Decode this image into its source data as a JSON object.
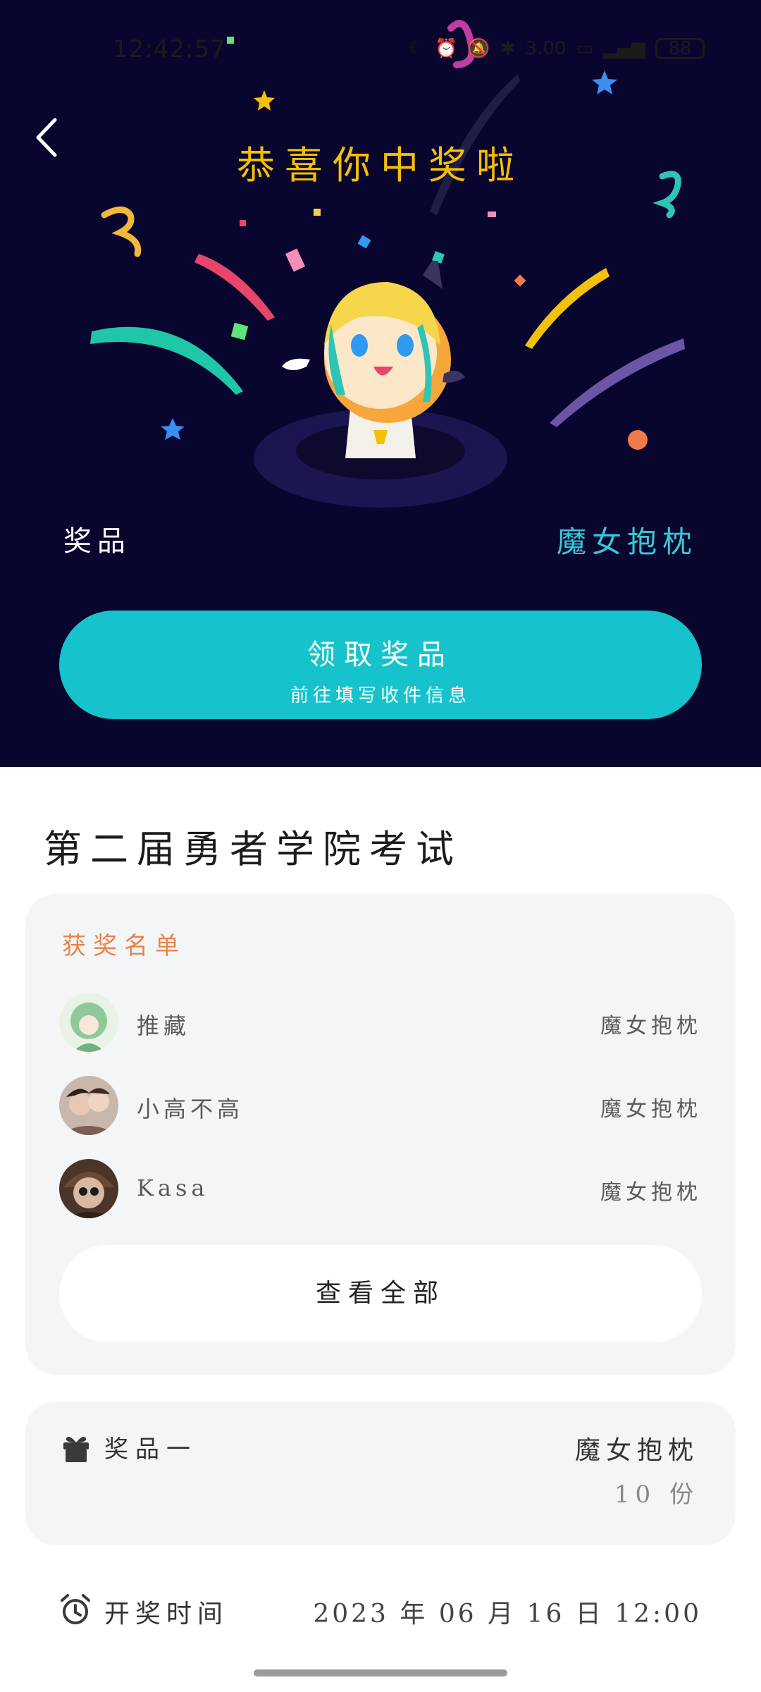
{
  "status_bar": {
    "time": "12:42:57",
    "icons": [
      "moon-icon",
      "alarm-icon",
      "mute-icon",
      "bluetooth-icon",
      "speed-icon",
      "hd-icon",
      "signal-icon"
    ],
    "network_speed": "3.00",
    "battery": "88"
  },
  "hero": {
    "title": "恭喜你中奖啦",
    "prize_label": "奖品",
    "prize_value": "魔女抱枕",
    "claim_button": {
      "label": "领取奖品",
      "sublabel": "前往填写收件信息"
    }
  },
  "event": {
    "title": "第二届勇者学院考试"
  },
  "winners": {
    "heading": "获奖名单",
    "items": [
      {
        "name": "推藏",
        "prize": "魔女抱枕",
        "avatar_color": "#8fc99b"
      },
      {
        "name": "小高不高",
        "prize": "魔女抱枕",
        "avatar_color": "#7a5f55"
      },
      {
        "name": "Kasa",
        "prize": "魔女抱枕",
        "avatar_color": "#4a3528"
      }
    ],
    "view_all": "查看全部"
  },
  "prize_info": {
    "label": "奖品一",
    "name": "魔女抱枕",
    "quantity": "10 份"
  },
  "draw_time": {
    "label": "开奖时间",
    "value": "2023 年 06 月 16 日 12:00"
  },
  "colors": {
    "hero_bg": "#08052f",
    "accent_teal": "#16c3cc",
    "title_gold": "#f5c000",
    "prize_teal": "#35c9d6",
    "winners_heading": "#e9834b"
  }
}
